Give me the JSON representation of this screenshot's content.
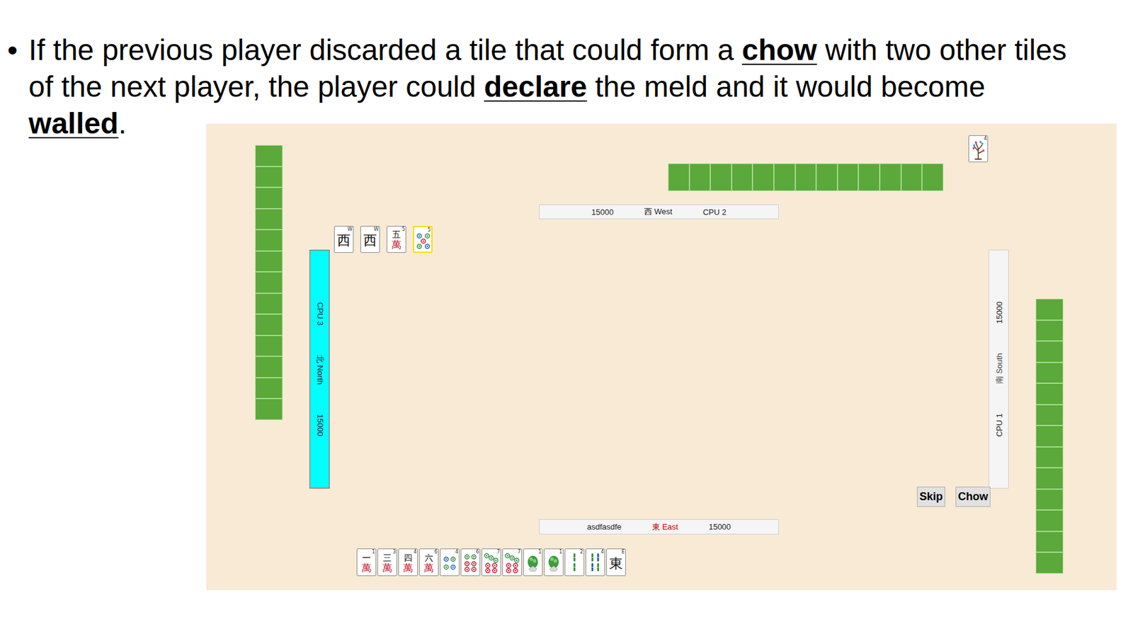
{
  "slide": {
    "bullet": "•",
    "segments": [
      {
        "text": "If the previous player discarded a tile that could form a ",
        "emphasis": false
      },
      {
        "text": "chow",
        "emphasis": true
      },
      {
        "text": " with two other tiles of the next player, the player could ",
        "emphasis": false
      },
      {
        "text": "declare",
        "emphasis": true
      },
      {
        "text": " the meld and it would become ",
        "emphasis": false
      },
      {
        "text": "walled",
        "emphasis": true
      },
      {
        "text": ".",
        "emphasis": false
      }
    ]
  },
  "game": {
    "walls": [
      13,
      13,
      13
    ],
    "flower_tile": {
      "kind": "flower",
      "corner": "4"
    },
    "players": [
      {
        "name": "CPU 2",
        "wind": "西 West",
        "points": "15000",
        "wind_color": "#222222",
        "active": false
      },
      {
        "name": "CPU 1",
        "wind": "南 South",
        "points": "15000",
        "wind_color": "#444444",
        "active": false
      },
      {
        "name": "asdfasdfe",
        "wind": "東 East",
        "points": "15000",
        "wind_color": "#c00000",
        "active": false
      },
      {
        "name": "CPU 3",
        "wind": "北 North",
        "points": "15000",
        "wind_color": "#222222",
        "active": true
      }
    ],
    "meld": [
      {
        "kind": "honor",
        "face": "西",
        "corner": "W",
        "selected": false
      },
      {
        "kind": "honor",
        "face": "西",
        "corner": "W",
        "selected": false
      },
      {
        "kind": "character",
        "rank": "五",
        "suit": "萬",
        "corner": "5",
        "selected": false
      },
      {
        "kind": "dots",
        "pips": 5,
        "corner": "5",
        "selected": true
      }
    ],
    "hand": [
      {
        "kind": "character",
        "rank": "一",
        "suit": "萬",
        "corner": "1"
      },
      {
        "kind": "character",
        "rank": "三",
        "suit": "萬",
        "corner": "3"
      },
      {
        "kind": "character",
        "rank": "四",
        "suit": "萬",
        "corner": "4"
      },
      {
        "kind": "character",
        "rank": "六",
        "suit": "萬",
        "corner": "6"
      },
      {
        "kind": "dots",
        "pips": 4,
        "corner": "4"
      },
      {
        "kind": "dots",
        "pips": 6,
        "corner": "6"
      },
      {
        "kind": "dots",
        "pips": 7,
        "corner": "7"
      },
      {
        "kind": "dots",
        "pips": 7,
        "corner": "7"
      },
      {
        "kind": "bamboo",
        "sticks": 1,
        "corner": "1"
      },
      {
        "kind": "bamboo",
        "sticks": 1,
        "corner": "1"
      },
      {
        "kind": "bamboo",
        "sticks": 2,
        "corner": "2"
      },
      {
        "kind": "bamboo",
        "sticks": 4,
        "corner": "4"
      },
      {
        "kind": "honor",
        "face": "東",
        "corner": "E"
      }
    ],
    "buttons": [
      {
        "label": "Skip"
      },
      {
        "label": "Chow"
      }
    ]
  }
}
